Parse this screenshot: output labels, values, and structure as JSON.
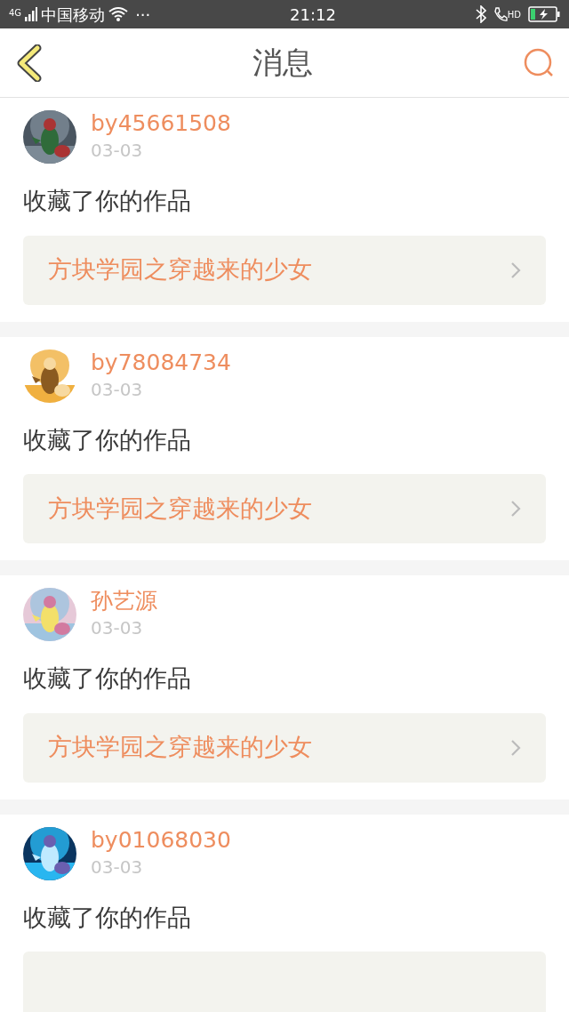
{
  "status_bar": {
    "network": "4G",
    "carrier": "中国移动",
    "more": "···",
    "time": "21:12",
    "call_badge": "HD"
  },
  "header": {
    "title": "消息"
  },
  "messages": [
    {
      "user": "by45661508",
      "date": "03-03",
      "action": "收藏了你的作品",
      "work": "方块学园之穿越来的少女"
    },
    {
      "user": "by78084734",
      "date": "03-03",
      "action": "收藏了你的作品",
      "work": "方块学园之穿越来的少女"
    },
    {
      "user": "孙艺源",
      "date": "03-03",
      "action": "收藏了你的作品",
      "work": "方块学园之穿越来的少女"
    },
    {
      "user": "by01068030",
      "date": "03-03",
      "action": "收藏了你的作品"
    }
  ]
}
